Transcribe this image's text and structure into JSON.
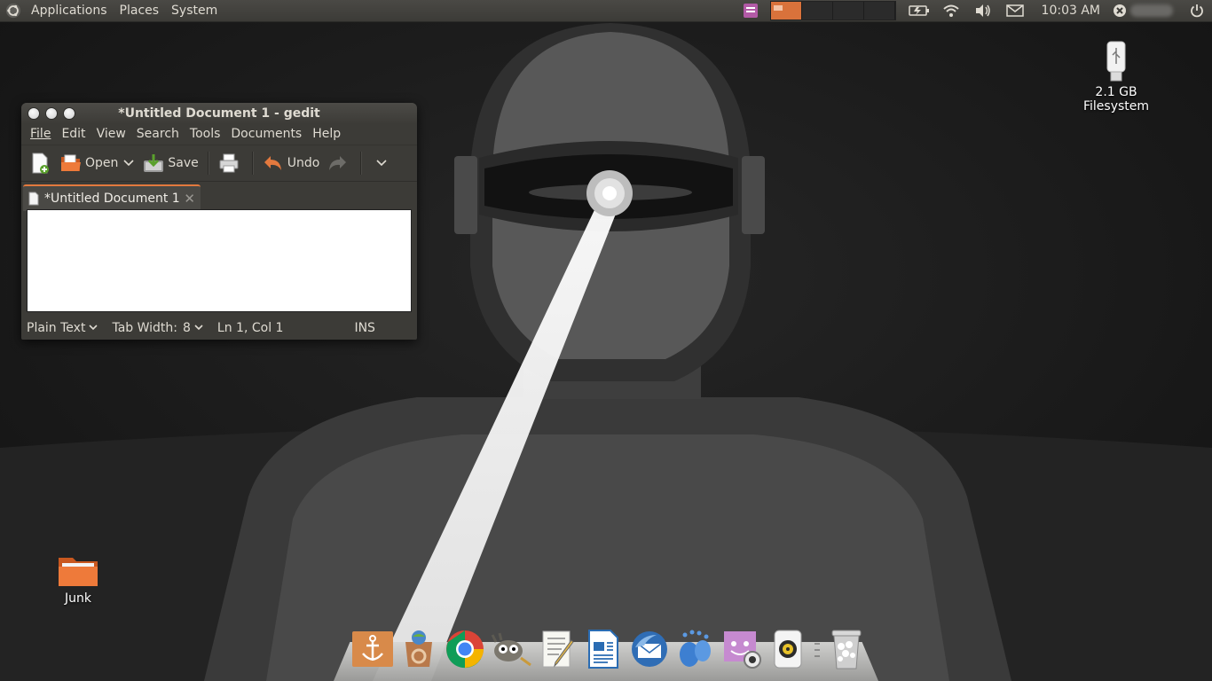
{
  "top_panel": {
    "menus": [
      "Applications",
      "Places",
      "System"
    ],
    "clock": "10:03 AM",
    "tray_icons": [
      "indicator-icon",
      "battery-icon",
      "wifi-icon",
      "volume-icon",
      "mail-icon"
    ],
    "workspaces": 4,
    "active_workspace": 1
  },
  "desktop": {
    "icons": [
      {
        "label": "2.1 GB Filesystem",
        "icon": "usb-drive-icon"
      },
      {
        "label": "Junk",
        "icon": "folder-icon"
      }
    ]
  },
  "gedit": {
    "title": "*Untitled Document 1 - gedit",
    "menu": [
      "File",
      "Edit",
      "View",
      "Search",
      "Tools",
      "Documents",
      "Help"
    ],
    "toolbar": {
      "open_label": "Open",
      "save_label": "Save",
      "undo_label": "Undo"
    },
    "tab_label": "*Untitled Document 1",
    "editor_text": "",
    "status": {
      "syntax": "Plain Text",
      "tab_width_label": "Tab Width:",
      "tab_width": "8",
      "position": "Ln 1, Col 1",
      "mode": "INS"
    }
  },
  "dock": {
    "items": [
      "anchor-icon",
      "software-center-icon",
      "chrome-icon",
      "gimp-icon",
      "text-editor-icon",
      "writer-icon",
      "thunderbird-icon",
      "empathy-icon",
      "cheese-icon",
      "rhythmbox-icon",
      "trash-icon"
    ]
  },
  "colors": {
    "panel_bg": "#3c3b37",
    "accent": "#e3793e",
    "wallpaper_bg": "#1a1a1a",
    "figure": "#4b4b4b"
  }
}
